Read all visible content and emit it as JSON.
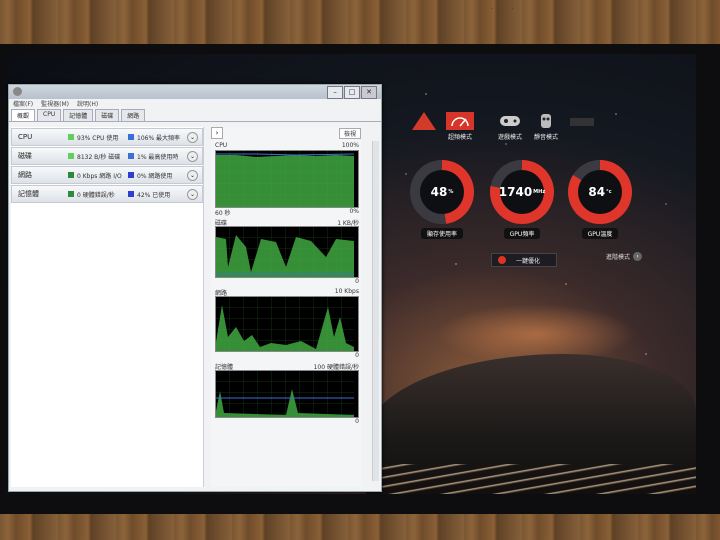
{
  "window": {
    "title": "",
    "menu": [
      "檔案(F)",
      "監視器(M)",
      "說明(H)"
    ],
    "tabs": [
      "概觀",
      "CPU",
      "記憶體",
      "磁碟",
      "網路"
    ]
  },
  "overview": [
    {
      "name": "CPU",
      "a_text": "93% CPU 使用",
      "a_color": "#5fcf5f",
      "b_text": "106% 最大頻率",
      "b_color": "#3a6fd8"
    },
    {
      "name": "磁碟",
      "a_text": "8132 B/秒 磁碟",
      "a_color": "#5fcf5f",
      "b_text": "1% 最高使用時",
      "b_color": "#3a6fd8"
    },
    {
      "name": "網路",
      "a_text": "0 Kbps 網路 I/O",
      "a_color": "#2c8a3c",
      "b_text": "0% 網路使用",
      "b_color": "#2e3fd0"
    },
    {
      "name": "記憶體",
      "a_text": "0 硬體錯誤/秒",
      "a_color": "#2c8a3c",
      "b_text": "42% 已使用",
      "b_color": "#2e3fd0"
    }
  ],
  "graphs": {
    "views_label": "檢視",
    "cpu": {
      "label": "CPU",
      "max": "100%",
      "foot_left": "60 秒",
      "foot_right": "0%"
    },
    "disk": {
      "label": "磁碟",
      "max": "1 KB/秒",
      "foot_right": "0"
    },
    "network": {
      "label": "網路",
      "max": "10 Kbps",
      "foot_right": "0"
    },
    "memory": {
      "label": "記憶體",
      "max": "100 硬體錯誤/秒",
      "foot_right": "0"
    }
  },
  "overclock": {
    "modes": [
      {
        "label": "",
        "icon": "triangle-icon"
      },
      {
        "label": "超頻模式",
        "icon": "speedometer-icon"
      },
      {
        "label": "遊戲模式",
        "icon": "gamepad-icon"
      },
      {
        "label": "靜音模式",
        "icon": "owl-icon"
      },
      {
        "label": "",
        "icon": "user-mode-icon"
      }
    ],
    "gauges": [
      {
        "value": "48",
        "unit": "%",
        "label": "顯存使用率",
        "percent": 48
      },
      {
        "value": "1740",
        "unit": "MHz",
        "label": "GPU頻率",
        "percent": 78
      },
      {
        "value": "84",
        "unit": "°c",
        "label": "GPU溫度",
        "percent": 84
      }
    ],
    "one_click": "一鍵優化",
    "advanced": "進階模式",
    "accent": "#e0352b"
  }
}
